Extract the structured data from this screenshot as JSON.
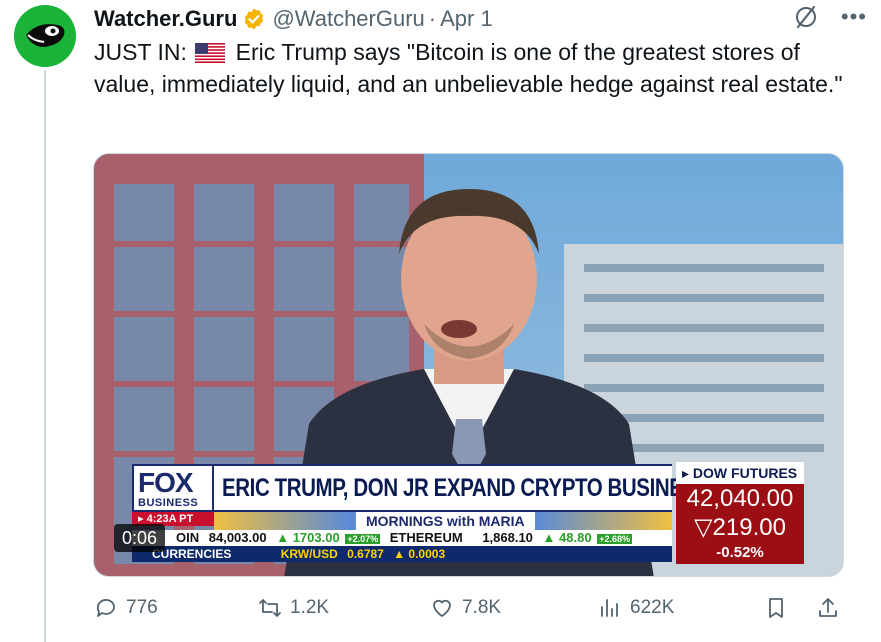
{
  "tweet": {
    "author_name": "Watcher.Guru",
    "handle": "@WatcherGuru",
    "separator": "·",
    "date": "Apr 1",
    "text_prefix": "JUST IN:",
    "text_body": "Eric Trump says \"Bitcoin is one of the greatest stores of value, immediately liquid, and an unbelievable hedge against real estate.\""
  },
  "video": {
    "timecode": "0:06",
    "network_logo": "FOX",
    "network_sub": "BUSINESS",
    "air_time": "▸ 4:23A PT",
    "headline": "ERIC TRUMP, DON JR EXPAND CRYPTO BUSINESS",
    "show_name": "MORNINGS with MARIA",
    "ticker_line1": {
      "coin_label": "OIN",
      "coin_value": "84,003.00",
      "coin_change": "▲ 1703.00",
      "coin_pct": "+2.07%",
      "eth_label": "ETHEREUM",
      "eth_value": "1,868.10",
      "eth_change": "▲ 48.80",
      "eth_pct": "+2.68%"
    },
    "ticker_line2": {
      "section": "CURRENCIES",
      "pair": "KRW/USD",
      "pair_value": "0.6787",
      "pair_change": "▲ 0.0003"
    },
    "dow": {
      "title": "▸ DOW FUTURES",
      "value": "42,040.00",
      "change": "▽219.00",
      "pct": "-0.52%"
    }
  },
  "actions": {
    "replies": "776",
    "reposts": "1.2K",
    "likes": "7.8K",
    "views": "622K"
  },
  "icons": {
    "avatar": "watcher-guru-logo",
    "verified": "verified-badge-icon",
    "grok": "grok-icon",
    "more": "more-icon",
    "flag": "us-flag-icon",
    "reply": "reply-icon",
    "repost": "repost-icon",
    "like": "heart-icon",
    "views": "views-icon",
    "bookmark": "bookmark-icon",
    "share": "share-icon"
  },
  "colors": {
    "avatar_bg": "#1ab43a",
    "verified": "#f4b400",
    "text_secondary": "#536471",
    "dow_red": "#9a0e14",
    "fox_blue": "#1a2a6c"
  }
}
